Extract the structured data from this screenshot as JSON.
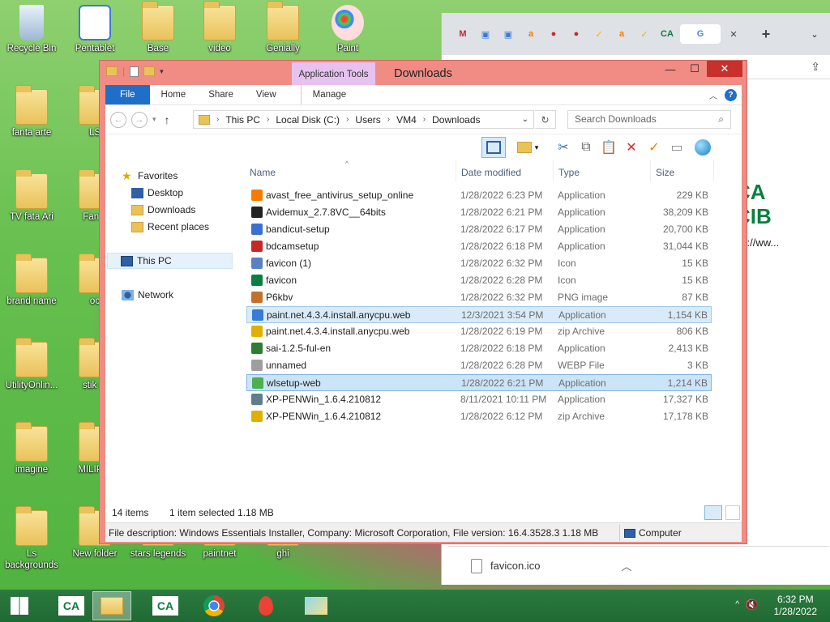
{
  "desktop": {
    "icons": [
      {
        "label": "Recycle Bin",
        "kind": "recycle"
      },
      {
        "label": "Pentablet",
        "kind": "app"
      },
      {
        "label": "Base",
        "kind": "folder"
      },
      {
        "label": "video",
        "kind": "folder"
      },
      {
        "label": "Genially",
        "kind": "folder"
      },
      {
        "label": "Paint",
        "kind": "paint"
      },
      {
        "label": "fanta arte",
        "kind": "folder"
      },
      {
        "label": "LS",
        "kind": "folder"
      },
      {
        "label": "TV fata Ari",
        "kind": "folder"
      },
      {
        "label": "Fanta",
        "kind": "folder"
      },
      {
        "label": "brand name",
        "kind": "folder"
      },
      {
        "label": "oc",
        "kind": "folder"
      },
      {
        "label": "UtilityOnlin...",
        "kind": "folder"
      },
      {
        "label": "stik m",
        "kind": "folder"
      },
      {
        "label": "imagine",
        "kind": "folder"
      },
      {
        "label": "MILIP R",
        "kind": "folder"
      },
      {
        "label": "Ls backgrounds",
        "kind": "folder"
      },
      {
        "label": "New folder",
        "kind": "folder"
      },
      {
        "label": "stars legends",
        "kind": "folder"
      },
      {
        "label": "paintnet",
        "kind": "folder"
      },
      {
        "label": "ghi",
        "kind": "folder"
      }
    ]
  },
  "chrome": {
    "tab_icons": [
      "mcafee-icon",
      "doc-icon",
      "doc-icon",
      "avast-icon",
      "record-icon",
      "record-icon",
      "check-icon",
      "avast-icon",
      "check-icon",
      "ca-icon",
      "google-icon"
    ],
    "close_tab": "✕",
    "new_tab": "+",
    "page_partial_text": "s://ww...",
    "page_logo_partial": "CA CIB",
    "download_file": "favicon.ico"
  },
  "explorer": {
    "title": "Downloads",
    "app_tools": "Application Tools",
    "ribbon_tabs": [
      "File",
      "Home",
      "Share",
      "View",
      "Manage"
    ],
    "breadcrumb": [
      "This PC",
      "Local Disk (C:)",
      "Users",
      "VM4",
      "Downloads"
    ],
    "search_placeholder": "Search Downloads",
    "nav": {
      "favorites": "Favorites",
      "desktop": "Desktop",
      "downloads": "Downloads",
      "recent": "Recent places",
      "thispc": "This PC",
      "network": "Network"
    },
    "columns": [
      "Name",
      "Date modified",
      "Type",
      "Size"
    ],
    "files": [
      {
        "name": "avast_free_antivirus_setup_online",
        "date": "1/28/2022 6:23 PM",
        "type": "Application",
        "size": "229 KB",
        "icon": "avast-icon",
        "color": "#f57c00",
        "state": ""
      },
      {
        "name": "Avidemux_2.7.8VC__64bits",
        "date": "1/28/2022 6:21 PM",
        "type": "Application",
        "size": "38,209 KB",
        "icon": "clapper-icon",
        "color": "#222222",
        "state": ""
      },
      {
        "name": "bandicut-setup",
        "date": "1/28/2022 6:17 PM",
        "type": "Application",
        "size": "20,700 KB",
        "icon": "bandicut-icon",
        "color": "#3b6fd1",
        "state": ""
      },
      {
        "name": "bdcamsetup",
        "date": "1/28/2022 6:18 PM",
        "type": "Application",
        "size": "31,044 KB",
        "icon": "bandicam-icon",
        "color": "#c62828",
        "state": ""
      },
      {
        "name": "favicon (1)",
        "date": "1/28/2022 6:32 PM",
        "type": "Icon",
        "size": "15 KB",
        "icon": "image-icon",
        "color": "#5b7fc4",
        "state": ""
      },
      {
        "name": "favicon",
        "date": "1/28/2022 6:28 PM",
        "type": "Icon",
        "size": "15 KB",
        "icon": "ca-icon",
        "color": "#0a7f3f",
        "state": ""
      },
      {
        "name": "P6kbv",
        "date": "1/28/2022 6:32 PM",
        "type": "PNG image",
        "size": "87 KB",
        "icon": "png-icon",
        "color": "#c2702c",
        "state": ""
      },
      {
        "name": "paint.net.4.3.4.install.anycpu.web",
        "date": "12/3/2021 3:54 PM",
        "type": "Application",
        "size": "1,154 KB",
        "icon": "installer-icon",
        "color": "#3a7bd5",
        "state": "hover"
      },
      {
        "name": "paint.net.4.3.4.install.anycpu.web",
        "date": "1/28/2022 6:19 PM",
        "type": "zip Archive",
        "size": "806 KB",
        "icon": "zip-icon",
        "color": "#e0b000",
        "state": ""
      },
      {
        "name": "sai-1.2.5-ful-en",
        "date": "1/28/2022 6:18 PM",
        "type": "Application",
        "size": "2,413 KB",
        "icon": "sai-icon",
        "color": "#2e7d32",
        "state": ""
      },
      {
        "name": "unnamed",
        "date": "1/28/2022 6:28 PM",
        "type": "WEBP File",
        "size": "3 KB",
        "icon": "file-icon",
        "color": "#9e9e9e",
        "state": ""
      },
      {
        "name": "wlsetup-web",
        "date": "1/28/2022 6:21 PM",
        "type": "Application",
        "size": "1,214 KB",
        "icon": "windows-live-icon",
        "color": "#4caf50",
        "state": "selected"
      },
      {
        "name": "XP-PENWin_1.6.4.210812",
        "date": "8/11/2021 10:11 PM",
        "type": "Application",
        "size": "17,327 KB",
        "icon": "installer-icon",
        "color": "#607d8b",
        "state": ""
      },
      {
        "name": "XP-PENWin_1.6.4.210812",
        "date": "1/28/2022 6:12 PM",
        "type": "zip Archive",
        "size": "17,178 KB",
        "icon": "zip-icon",
        "color": "#e0b000",
        "state": ""
      }
    ],
    "status": {
      "items": "14 items",
      "selected": "1 item selected  1.18 MB"
    },
    "details": {
      "description": "File description: Windows Essentials Installer, Company: Microsoft Corporation, File version: 16.4.3528.3  1.18 MB",
      "location": "Computer"
    }
  },
  "taskbar": {
    "items": [
      "start-button",
      "ca-icon",
      "file-explorer-icon",
      "ca-icon",
      "chrome-icon",
      "maps-icon",
      "folders-icon"
    ],
    "active_index": 2,
    "time": "6:32 PM",
    "date": "1/28/2022"
  }
}
